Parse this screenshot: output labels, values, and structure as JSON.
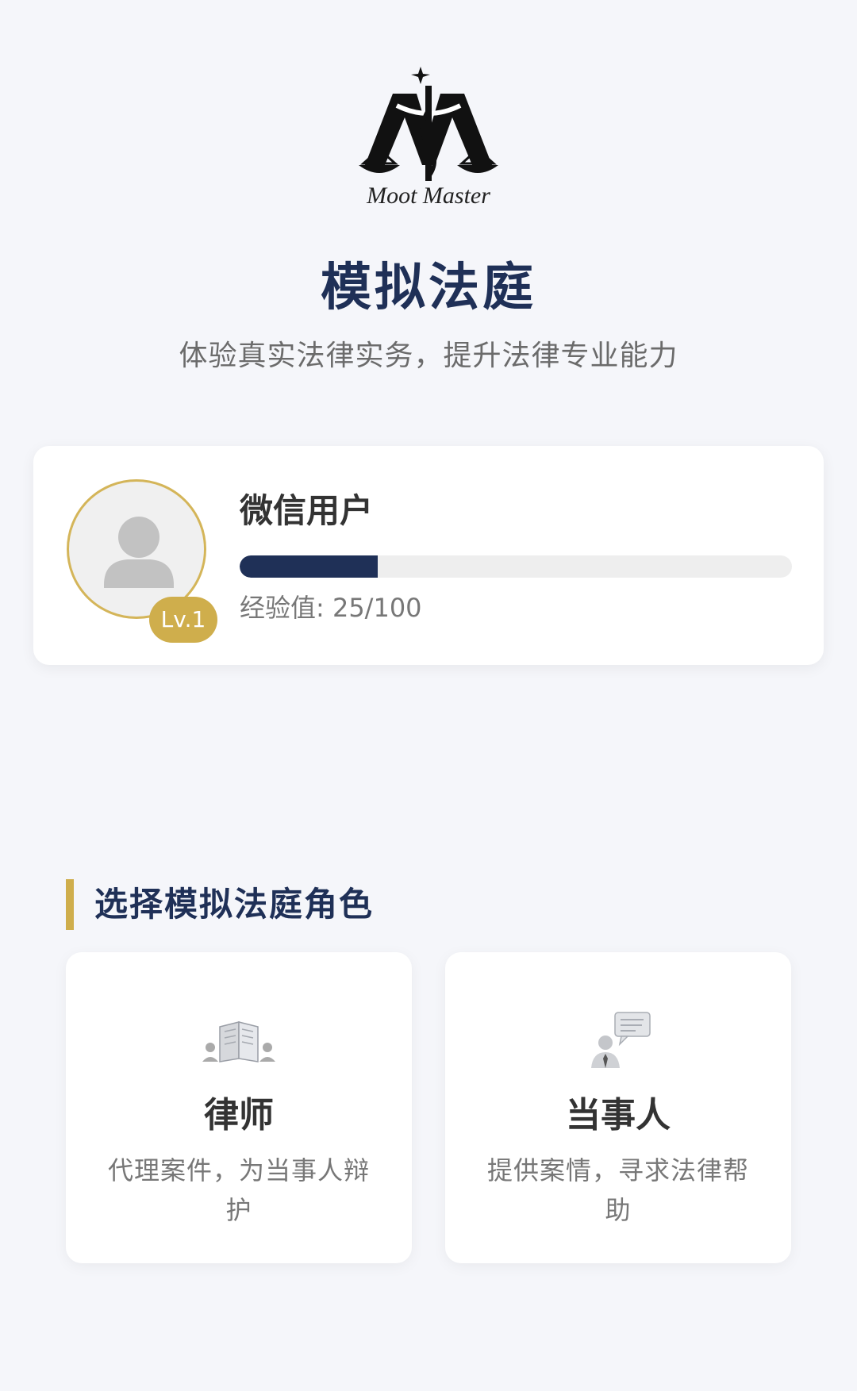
{
  "header": {
    "logo_text": "Moot Master",
    "title": "模拟法庭",
    "subtitle": "体验真实法律实务，提升法律专业能力"
  },
  "user": {
    "name": "微信用户",
    "level": "Lv.1",
    "exp_text": "经验值: 25/100",
    "exp_current": 25,
    "exp_max": 100
  },
  "roles": {
    "section_title": "选择模拟法庭角色",
    "items": [
      {
        "name": "律师",
        "description": "代理案件，为当事人辩护",
        "icon": "book-icon"
      },
      {
        "name": "当事人",
        "description": "提供案情，寻求法律帮助",
        "icon": "person-chat-icon"
      }
    ]
  },
  "colors": {
    "primary": "#1f3057",
    "accent": "#cfae4c",
    "background": "#f5f6fa"
  }
}
